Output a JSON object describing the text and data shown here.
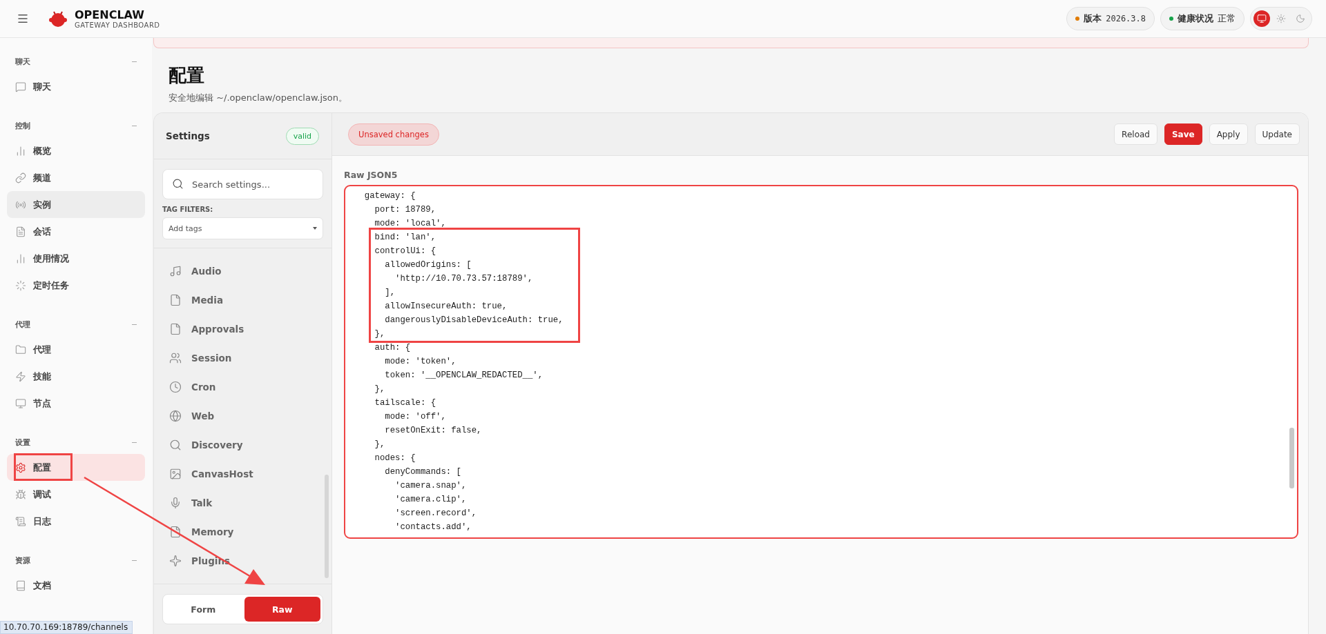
{
  "header": {
    "brand": "OPENCLAW",
    "subtitle": "GATEWAY DASHBOARD",
    "version": {
      "label": "版本",
      "value": "2026.3.8",
      "color": "#e07b00"
    },
    "health": {
      "label": "健康状况",
      "value": "正常",
      "color": "#16a34a"
    },
    "themes": [
      {
        "selected": true
      },
      {
        "selected": false
      },
      {
        "selected": false
      }
    ]
  },
  "sidebar": {
    "groups": [
      {
        "label": "聊天",
        "items": [
          {
            "label": "聊天",
            "selected": false,
            "hovered": false
          }
        ]
      },
      {
        "label": "控制",
        "items": [
          {
            "label": "概览",
            "selected": false,
            "hovered": false
          },
          {
            "label": "频道",
            "selected": false,
            "hovered": false
          },
          {
            "label": "实例",
            "selected": false,
            "hovered": true
          },
          {
            "label": "会话",
            "selected": false,
            "hovered": false
          },
          {
            "label": "使用情况",
            "selected": false,
            "hovered": false
          },
          {
            "label": "定时任务",
            "selected": false,
            "hovered": false
          }
        ]
      },
      {
        "label": "代理",
        "items": [
          {
            "label": "代理",
            "selected": false,
            "hovered": false
          },
          {
            "label": "技能",
            "selected": false,
            "hovered": false
          },
          {
            "label": "节点",
            "selected": false,
            "hovered": false
          }
        ]
      },
      {
        "label": "设置",
        "items": [
          {
            "label": "配置",
            "selected": true,
            "hovered": false
          },
          {
            "label": "调试",
            "selected": false,
            "hovered": false
          },
          {
            "label": "日志",
            "selected": false,
            "hovered": false
          }
        ]
      },
      {
        "label": "资源",
        "items": [
          {
            "label": "文档",
            "selected": false,
            "hovered": false
          }
        ]
      }
    ]
  },
  "page": {
    "title": "配置",
    "subtitle": "安全地编辑 ~/.openclaw/openclaw.json。"
  },
  "settings": {
    "title": "Settings",
    "status": "valid",
    "search": {
      "placeholder": "Search settings..."
    },
    "tag_filters_label": "TAG FILTERS:",
    "tags": {
      "placeholder": "Add tags"
    },
    "sections": [
      "Audio",
      "Media",
      "Approvals",
      "Session",
      "Cron",
      "Web",
      "Discovery",
      "CanvasHost",
      "Talk",
      "Memory",
      "Plugins"
    ],
    "modes": [
      {
        "label": "Form",
        "selected": false
      },
      {
        "label": "Raw",
        "selected": true
      }
    ]
  },
  "editor": {
    "status": "Unsaved changes",
    "actions": [
      {
        "label": "Reload",
        "primary": false
      },
      {
        "label": "Save",
        "primary": true
      },
      {
        "label": "Apply",
        "primary": false
      },
      {
        "label": "Update",
        "primary": false
      }
    ],
    "label": "Raw JSON5",
    "lines": [
      "  gateway: {",
      "    port: 18789,",
      "    mode: 'local',",
      "    bind: 'lan',",
      "    controlUi: {",
      "      allowedOrigins: [",
      "        'http://10.70.73.57:18789',",
      "      ],",
      "      allowInsecureAuth: true,",
      "      dangerouslyDisableDeviceAuth: true,",
      "    },",
      "    auth: {",
      "      mode: 'token',",
      "      token: '__OPENCLAW_REDACTED__',",
      "    },",
      "    tailscale: {",
      "      mode: 'off',",
      "      resetOnExit: false,",
      "    },",
      "    nodes: {",
      "      denyCommands: [",
      "        'camera.snap',",
      "        'camera.clip',",
      "        'screen.record',",
      "        'contacts.add',"
    ]
  },
  "status_bar": {
    "url": "10.70.70.169:18789/channels"
  }
}
